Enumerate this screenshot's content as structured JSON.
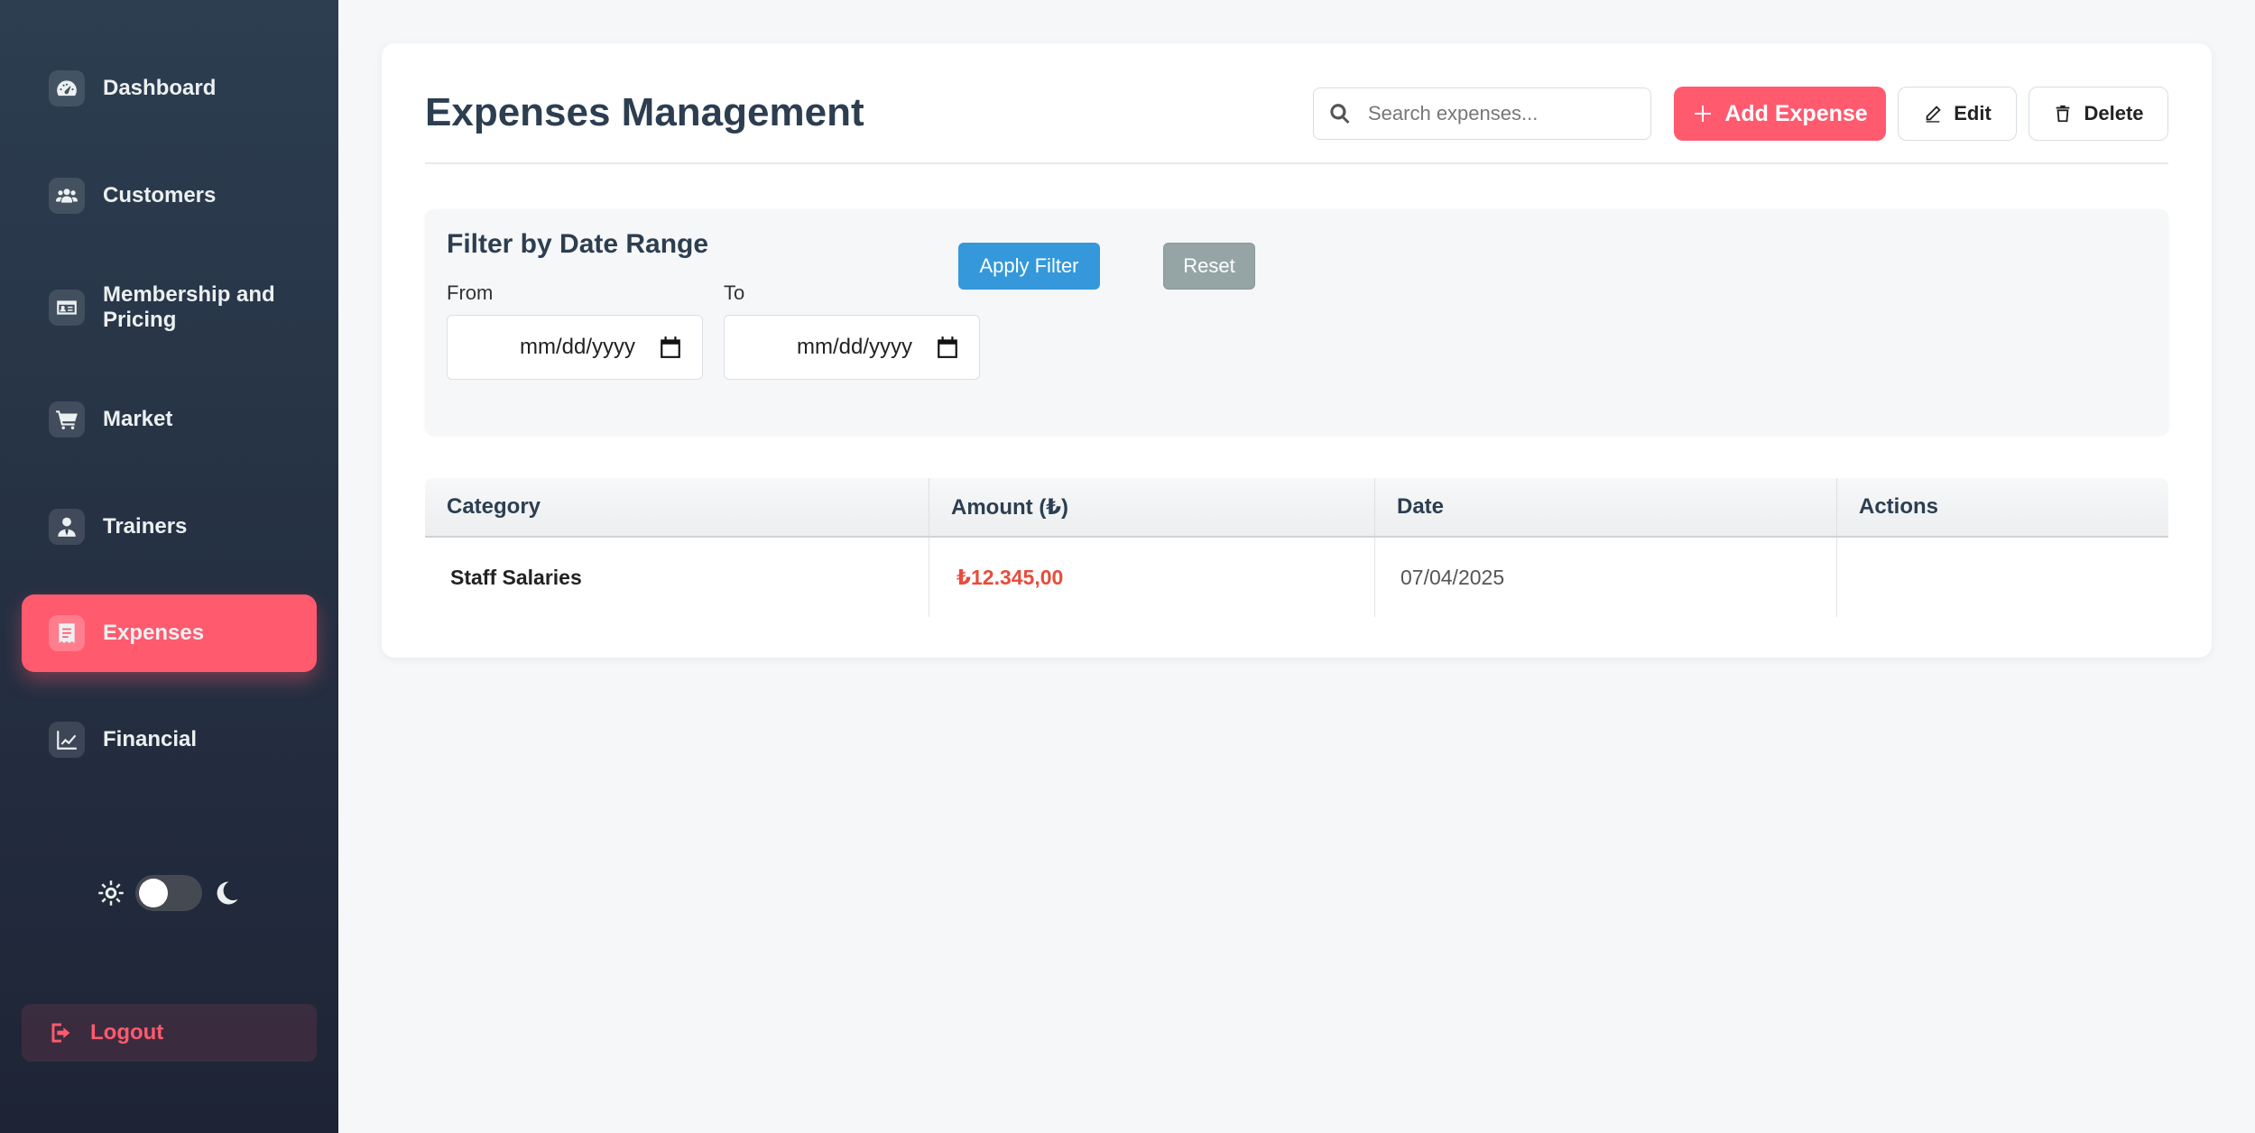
{
  "sidebar": {
    "items": [
      {
        "label": "Dashboard",
        "icon": "dashboard-gauge-icon",
        "active": false
      },
      {
        "label": "Customers",
        "icon": "users-icon",
        "active": false
      },
      {
        "label": "Membership and Pricing",
        "icon": "id-card-icon",
        "active": false
      },
      {
        "label": "Market",
        "icon": "shopping-cart-icon",
        "active": false
      },
      {
        "label": "Trainers",
        "icon": "user-tie-icon",
        "active": false
      },
      {
        "label": "Expenses",
        "icon": "receipt-icon",
        "active": true
      },
      {
        "label": "Financial",
        "icon": "chart-line-icon",
        "active": false
      }
    ],
    "theme_toggle": {
      "state": "light"
    },
    "logout_label": "Logout"
  },
  "header": {
    "title": "Expenses Management",
    "search_placeholder": "Search expenses...",
    "add_label": "Add Expense",
    "edit_label": "Edit",
    "delete_label": "Delete"
  },
  "filter": {
    "title": "Filter by Date Range",
    "from_label": "From",
    "to_label": "To",
    "from_value": "mm/dd/yyyy",
    "to_value": "mm/dd/yyyy",
    "apply_label": "Apply Filter",
    "reset_label": "Reset"
  },
  "table": {
    "columns": [
      "Category",
      "Amount (₺)",
      "Date",
      "Actions"
    ],
    "rows": [
      {
        "category": "Staff Salaries",
        "amount": "₺12.345,00",
        "date": "07/04/2025",
        "actions": ""
      }
    ]
  },
  "colors": {
    "accent": "#ff5a6e",
    "sidebar_top": "#2c3e50",
    "sidebar_bottom": "#1e2436",
    "apply_button": "#3498db",
    "reset_button": "#95a5a6",
    "amount_text": "#e74c3c"
  }
}
